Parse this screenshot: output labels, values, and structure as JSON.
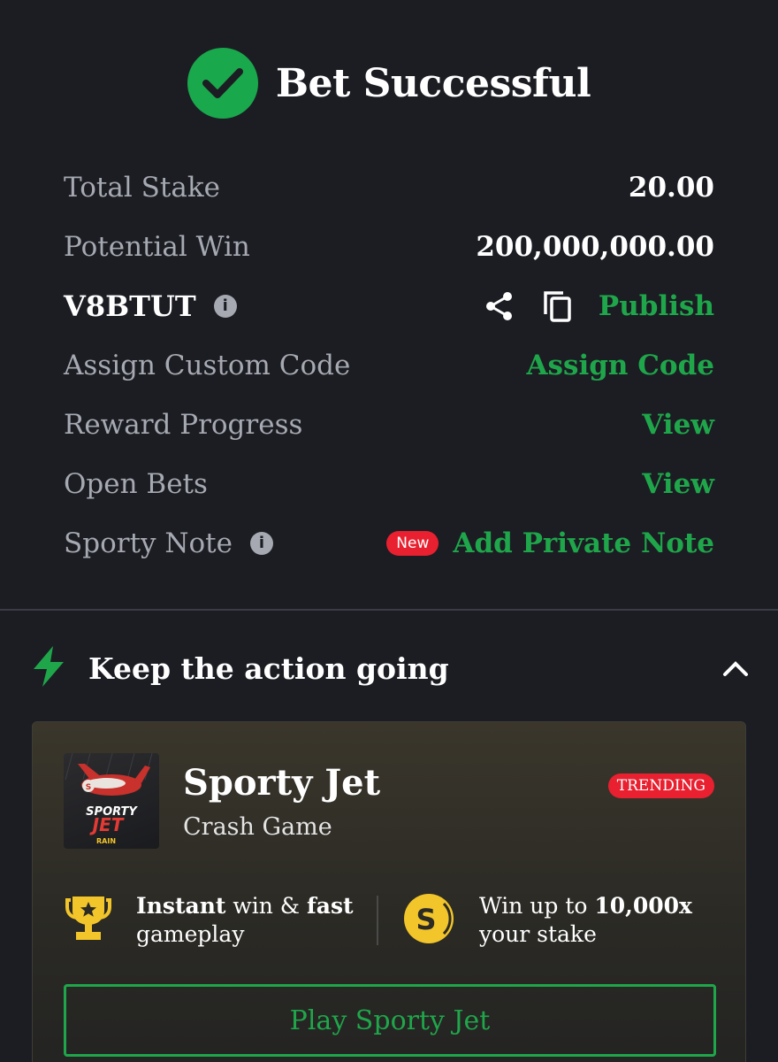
{
  "header": {
    "title": "Bet Successful",
    "icon": "check-circle-icon"
  },
  "summary": {
    "total_stake_label": "Total Stake",
    "total_stake_value": "20.00",
    "potential_win_label": "Potential Win",
    "potential_win_value": "200,000,000.00",
    "booking_code": "V8BTUT",
    "publish_label": "Publish",
    "assign_label": "Assign Custom Code",
    "assign_link": "Assign Code",
    "reward_label": "Reward Progress",
    "reward_link": "View",
    "open_bets_label": "Open Bets",
    "open_bets_link": "View",
    "note_label": "Sporty Note",
    "note_badge": "New",
    "note_link": "Add Private Note"
  },
  "section": {
    "title": "Keep the action going"
  },
  "promo": {
    "game_name": "Sporty Jet",
    "game_type": "Crash Game",
    "trending_badge": "TRENDING",
    "thumb_line1": "SPORTY",
    "thumb_line2": "JET",
    "thumb_line3": "RAIN",
    "feature1_bold1": "Instant",
    "feature1_text1": " win & ",
    "feature1_bold2": "fast",
    "feature1_text2": "gameplay",
    "feature2_text1": "Win up to ",
    "feature2_bold": "10,000x",
    "feature2_text2": "your stake",
    "play_button": "Play Sporty Jet"
  },
  "colors": {
    "background": "#1b1d23",
    "accent_green": "#1fa64a",
    "badge_red": "#e8202f",
    "muted_text": "#a6a9b1"
  }
}
